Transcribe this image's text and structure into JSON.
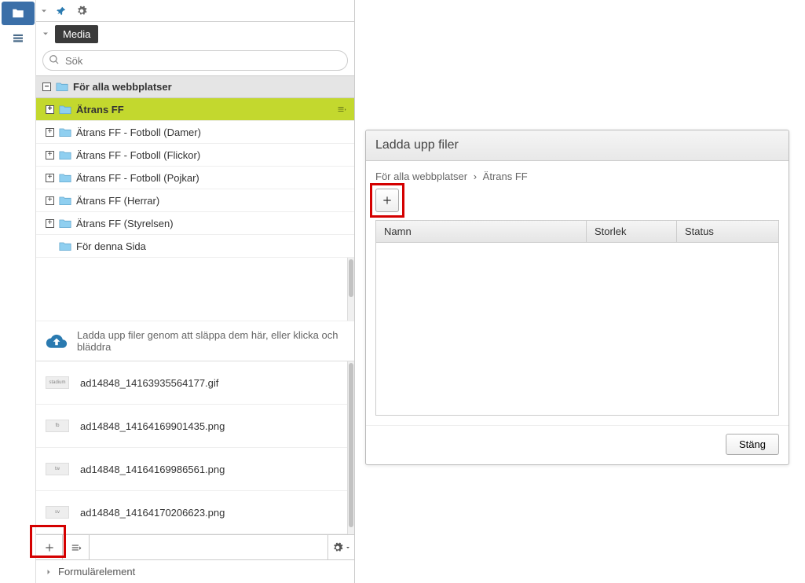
{
  "rail": {
    "items": [
      "folder",
      "list"
    ]
  },
  "breadcrumb": {
    "label": "Media"
  },
  "search": {
    "placeholder": "Sök"
  },
  "tree": {
    "root_label": "För alla webbplatser",
    "items": [
      {
        "label": "Ätrans FF",
        "selected": true
      },
      {
        "label": "Ätrans FF - Fotboll (Damer)"
      },
      {
        "label": "Ätrans FF - Fotboll (Flickor)"
      },
      {
        "label": "Ätrans FF - Fotboll (Pojkar)"
      },
      {
        "label": "Ätrans FF (Herrar)"
      },
      {
        "label": "Ätrans FF (Styrelsen)"
      },
      {
        "label": "För denna Sida",
        "no_expand": true
      }
    ]
  },
  "upload_hint": "Ladda upp filer genom att släppa dem här, eller klicka och bläddra",
  "files": [
    {
      "name": "ad14848_14163935564177.gif",
      "thumb": "stadium"
    },
    {
      "name": "ad14848_14164169901435.png",
      "thumb": "fb"
    },
    {
      "name": "ad14848_14164169986561.png",
      "thumb": "tw"
    },
    {
      "name": "ad14848_14164170206623.png",
      "thumb": "sv"
    }
  ],
  "accordion": {
    "label": "Formulärelement"
  },
  "dialog": {
    "title": "Ladda upp filer",
    "crumb_root": "För alla webbplatser",
    "crumb_sep": "›",
    "crumb_leaf": "Ätrans FF",
    "columns": {
      "c1": "Namn",
      "c2": "Storlek",
      "c3": "Status"
    },
    "close_label": "Stäng"
  }
}
